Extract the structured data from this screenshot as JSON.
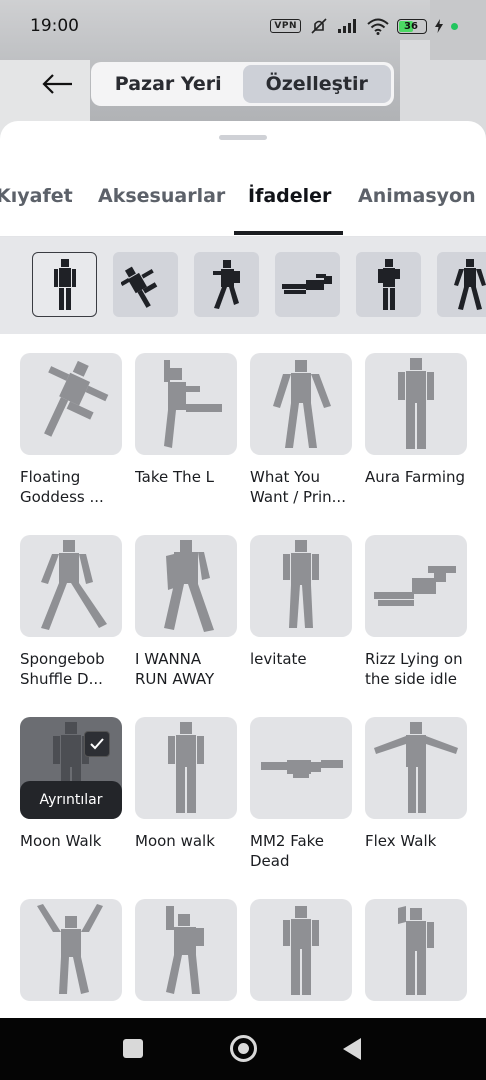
{
  "status_bar": {
    "time": "19:00",
    "vpn_label": "VPN",
    "battery_level": "36",
    "icons": [
      "vpn-icon",
      "mute-icon",
      "signal-icon",
      "wifi-icon",
      "battery-icon",
      "charging-icon"
    ]
  },
  "top_nav": {
    "back_icon": "arrow-left-icon",
    "segments": [
      {
        "label": "Pazar Yeri",
        "active": false
      },
      {
        "label": "Özelleştir",
        "active": true
      }
    ]
  },
  "tabs": [
    {
      "label": "Kıyafet",
      "active": false
    },
    {
      "label": "Aksesuarlar",
      "active": false
    },
    {
      "label": "İfadeler",
      "active": true
    },
    {
      "label": "Animasyon",
      "active": false
    }
  ],
  "filters": [
    {
      "icon": "standing-pose-icon",
      "selected": true
    },
    {
      "icon": "falling-pose-icon",
      "selected": false
    },
    {
      "icon": "running-pose-icon",
      "selected": false
    },
    {
      "icon": "lying-pose-icon",
      "selected": false
    },
    {
      "icon": "idle-pose-icon",
      "selected": false
    },
    {
      "icon": "walking-pose-icon",
      "selected": false
    }
  ],
  "emotes": [
    {
      "label": "Floating Goddess ...",
      "pose": "float"
    },
    {
      "label": "Take The L",
      "pose": "kick"
    },
    {
      "label": "What You Want / Prin...",
      "pose": "armsout"
    },
    {
      "label": "Aura Farming",
      "pose": "stand"
    },
    {
      "label": "Spongebob Shuffle D...",
      "pose": "shuffle"
    },
    {
      "label": "I WANNA RUN AWAY",
      "pose": "run"
    },
    {
      "label": "levitate",
      "pose": "stand"
    },
    {
      "label": "Rizz Lying on the side idle",
      "pose": "lying"
    },
    {
      "label": "Moon Walk",
      "pose": "stand",
      "equipped": true
    },
    {
      "label": "Moon walk",
      "pose": "stand"
    },
    {
      "label": "MM2 Fake Dead",
      "pose": "flat"
    },
    {
      "label": "Flex Walk",
      "pose": "tpose"
    },
    {
      "label": "",
      "pose": "cheer"
    },
    {
      "label": "",
      "pose": "dance"
    },
    {
      "label": "",
      "pose": "stand"
    },
    {
      "label": "",
      "pose": "salute"
    }
  ],
  "details_label": "Ayrıntılar",
  "nav_bar": [
    "recents-icon",
    "home-icon",
    "back-icon"
  ]
}
